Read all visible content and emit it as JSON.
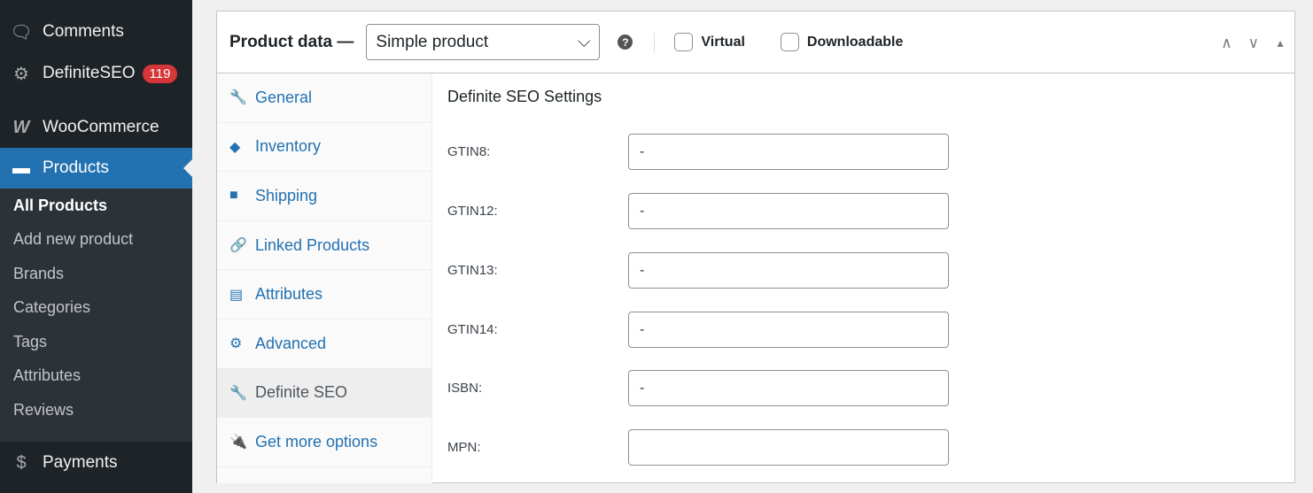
{
  "sidebar": {
    "comments": "Comments",
    "definiteseo": "DefiniteSEO",
    "badge": "119",
    "woocommerce": "WooCommerce",
    "products": "Products",
    "payments": "Payments",
    "sub": [
      "All Products",
      "Add new product",
      "Brands",
      "Categories",
      "Tags",
      "Attributes",
      "Reviews"
    ]
  },
  "panel": {
    "title": "Product data —",
    "type": "Simple product",
    "help": "?",
    "virtual": "Virtual",
    "downloadable": "Downloadable"
  },
  "tabs": [
    "General",
    "Inventory",
    "Shipping",
    "Linked Products",
    "Attributes",
    "Advanced",
    "Definite SEO",
    "Get more options"
  ],
  "seo": {
    "title": "Definite SEO Settings",
    "fields": [
      {
        "label": "GTIN8:",
        "value": "-"
      },
      {
        "label": "GTIN12:",
        "value": "-"
      },
      {
        "label": "GTIN13:",
        "value": "-"
      },
      {
        "label": "GTIN14:",
        "value": "-"
      },
      {
        "label": "ISBN:",
        "value": "-"
      },
      {
        "label": "MPN:",
        "value": ""
      }
    ]
  }
}
